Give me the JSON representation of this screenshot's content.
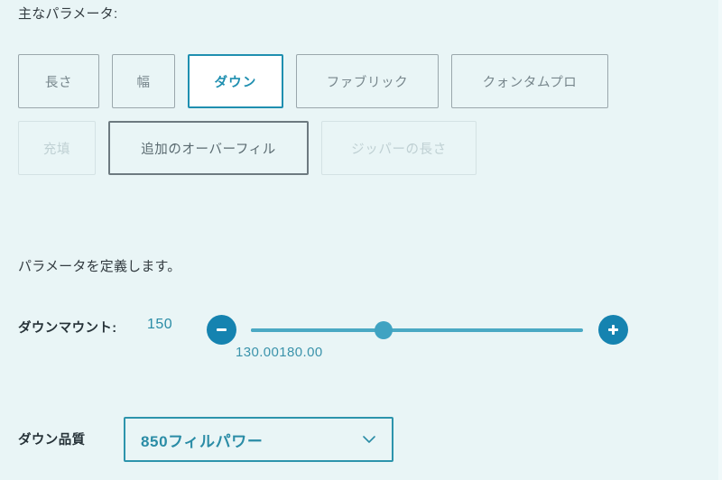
{
  "theme": {
    "background": "#e9f5f6",
    "accent": "#1f8fb0",
    "accent_light": "#4aa9c4",
    "text_dark": "#263238",
    "text_muted": "#77868c",
    "text_disabled": "#bfd0d3"
  },
  "section": {
    "title": "主なパラメータ:"
  },
  "parameter_chips": {
    "row1": [
      {
        "label": "長さ",
        "state": "default",
        "width_class": "w-len"
      },
      {
        "label": "幅",
        "state": "default",
        "width_class": "w-wid"
      },
      {
        "label": "ダウン",
        "state": "selected",
        "width_class": "w-down"
      },
      {
        "label": "ファブリック",
        "state": "default",
        "width_class": "w-fab"
      },
      {
        "label": "クォンタムプロ",
        "state": "default",
        "width_class": "w-qpro"
      }
    ],
    "row2": [
      {
        "label": "充填",
        "state": "disabled",
        "width_class": "w-fill"
      },
      {
        "label": "追加のオーバーフィル",
        "state": "strong",
        "width_class": "w-over"
      },
      {
        "label": "ジッパーの長さ",
        "state": "disabled",
        "width_class": "w-zip"
      }
    ]
  },
  "define": {
    "caption": "パラメータを定義します。"
  },
  "slider": {
    "label": "ダウンマウント:",
    "value": "150",
    "min_label": "130.00",
    "max_label": "180.00",
    "min": 130,
    "max": 180,
    "current": 150,
    "decrement_icon": "minus-icon",
    "increment_icon": "plus-icon"
  },
  "select": {
    "label": "ダウン品質",
    "value": "850フィルパワー",
    "chevron_icon": "chevron-down-icon"
  }
}
